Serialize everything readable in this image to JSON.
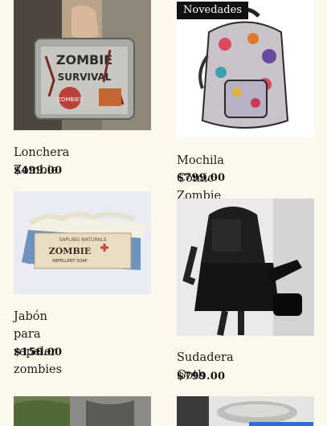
{
  "products": [
    {
      "title": "Lonchera Zombie",
      "price": "$499.00"
    },
    {
      "title": "Mochila Comic Zombie",
      "price": "$799.00",
      "badge": "Novedades"
    },
    {
      "title": "Jabón para repeler zombies",
      "title_line1": "Jabón para repeler",
      "title_line2": "zombies",
      "price": "$150.00"
    },
    {
      "title": "Sudadera Goth",
      "price": "$799.00"
    }
  ],
  "images": {
    "lunchbox_text_1": "ZOMBIE",
    "lunchbox_text_2": "SURVIVAL",
    "lunchbox_text_3": "ZOMBIES",
    "soap_brand": "SAPLING NATURALS",
    "soap_name": "ZOMBIE",
    "soap_sub": "REPELLENT SOAP"
  }
}
